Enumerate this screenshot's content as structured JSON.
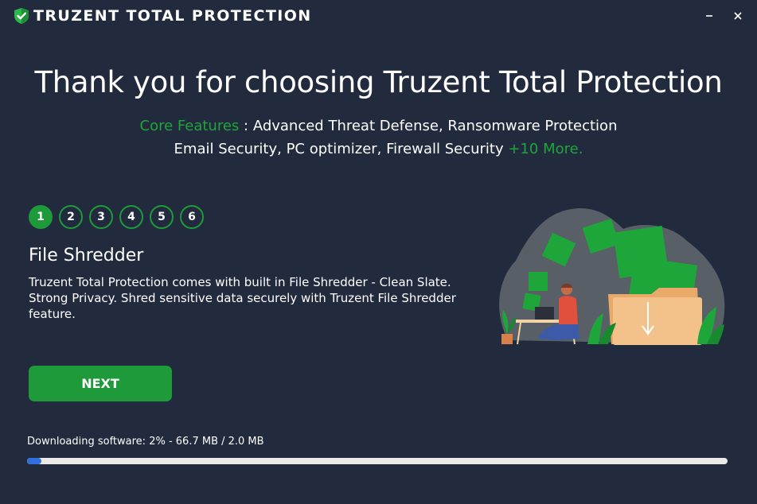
{
  "app": {
    "title": "TRUZENT TOTAL PROTECTION",
    "icons": {
      "logo": "shield-check-icon",
      "minimize": "minimize-icon",
      "close": "close-icon"
    }
  },
  "headline": "Thank you for choosing Truzent Total Protection",
  "features": {
    "label": "Core Features",
    "line1": ": Advanced Threat Defense, Ransomware Protection",
    "line2": "Email Security, PC optimizer, Firewall Security",
    "more": "+10 More."
  },
  "steps": [
    {
      "label": "1",
      "active": true
    },
    {
      "label": "2",
      "active": false
    },
    {
      "label": "3",
      "active": false
    },
    {
      "label": "4",
      "active": false
    },
    {
      "label": "5",
      "active": false
    },
    {
      "label": "6",
      "active": false
    }
  ],
  "feature": {
    "title": "File Shredder",
    "description": "Truzent Total Protection comes with built in File Shredder - Clean Slate. Strong Privacy. Shred sensitive data securely with Truzent File Shredder feature."
  },
  "next_button": "NEXT",
  "download": {
    "status": "Downloading software: 2% - 66.7 MB / 2.0 MB",
    "progress_percent": 2
  },
  "colors": {
    "background": "#222a3d",
    "accent_green": "#1f9a3a",
    "progress_blue": "#2f6fe0",
    "progress_track": "#eaeaea"
  }
}
